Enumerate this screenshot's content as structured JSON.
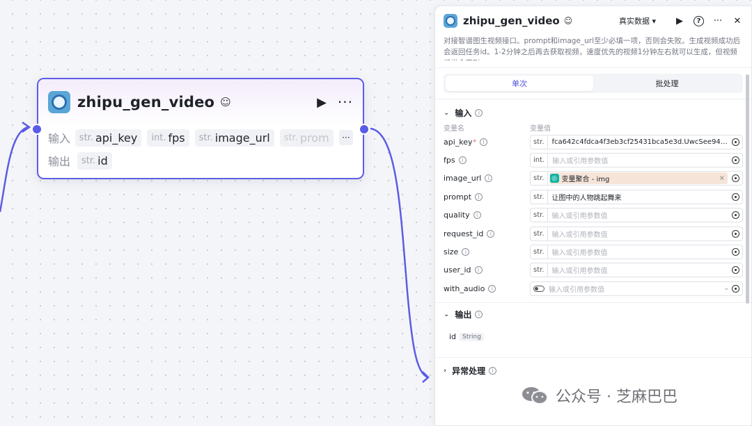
{
  "node": {
    "title": "zhipu_gen_video",
    "badge_icon": "robot-icon",
    "input_label": "输入",
    "output_label": "输出",
    "inputs": [
      {
        "type": "str.",
        "name": "api_key"
      },
      {
        "type": "int.",
        "name": "fps"
      },
      {
        "type": "str.",
        "name": "image_url"
      },
      {
        "type": "str.",
        "name": "prom"
      }
    ],
    "outputs": [
      {
        "type": "str.",
        "name": "id"
      }
    ],
    "more": "···"
  },
  "panel": {
    "title": "zhipu_gen_video",
    "mode": "真实数据 ▾",
    "description": "对接智谱图生视频接口。prompt和image_url至少必填一项，否则会失败。生成视频成功后会返回任务id。1-2分钟之后再去获取视频，速度优先的视频1分钟左右就可以生成，但视频经常会变形",
    "tabs": [
      "单次",
      "批处理"
    ],
    "input_section": "输入",
    "col_name": "变量名",
    "col_value": "变量值",
    "placeholder": "输入或引用参数值",
    "params": [
      {
        "name": "api_key",
        "type": "str.",
        "value": "fca642c4fdca4f3eb3cf25431bca5e3d.UwcSee946F7a···"
      },
      {
        "name": "fps",
        "type": "int.",
        "value": ""
      },
      {
        "name": "image_url",
        "type": "str.",
        "ref": "变量聚合 - img"
      },
      {
        "name": "prompt",
        "type": "str.",
        "value": "让图中的人物跳起舞来"
      },
      {
        "name": "quality",
        "type": "str.",
        "value": ""
      },
      {
        "name": "request_id",
        "type": "str.",
        "value": ""
      },
      {
        "name": "size",
        "type": "str.",
        "value": ""
      },
      {
        "name": "user_id",
        "type": "str.",
        "value": ""
      },
      {
        "name": "with_audio",
        "type": "toggle",
        "value": ""
      }
    ],
    "output_section": "输出",
    "output_item": {
      "name": "id",
      "type": "String"
    },
    "error_section": "异常处理"
  },
  "watermark": "公众号 · 芝麻巴巴",
  "colors": {
    "accent": "#5b5ce6",
    "ref_bg": "#f6e4d9",
    "ref_icon": "#10b3a3"
  }
}
